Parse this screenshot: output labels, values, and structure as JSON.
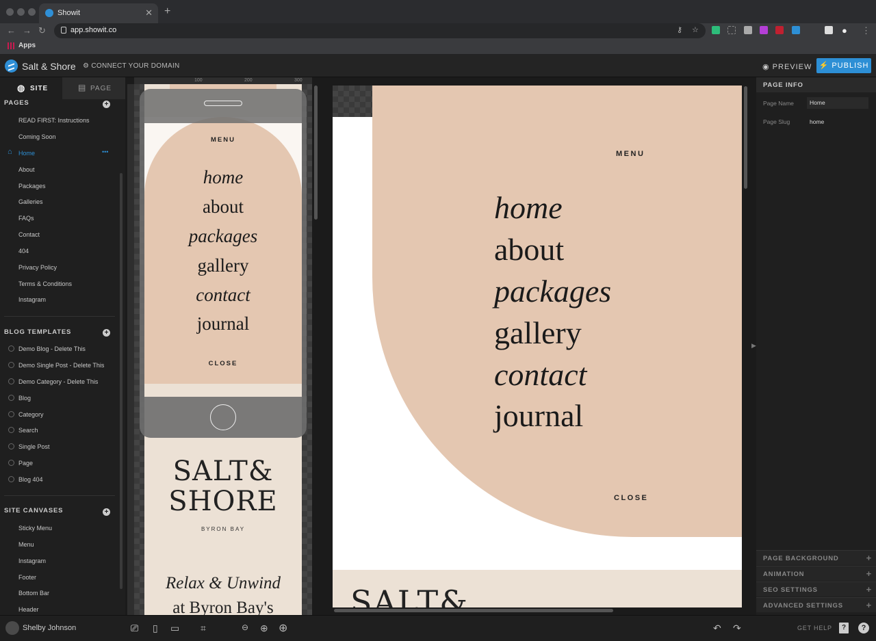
{
  "browser": {
    "tab_title": "Showit",
    "url": "app.showit.co",
    "bookmarks_label": "Apps"
  },
  "header": {
    "site_name": "Salt & Shore",
    "connect_domain": "CONNECT YOUR DOMAIN",
    "preview": "PREVIEW",
    "publish": "PUBLISH"
  },
  "sidebar": {
    "tab_site": "SITE",
    "tab_page": "PAGE",
    "pages_header": "PAGES",
    "pages": [
      "READ FIRST: Instructions",
      "Coming Soon",
      "Home",
      "About",
      "Packages",
      "Galleries",
      "FAQs",
      "Contact",
      "404",
      "Privacy Policy",
      "Terms & Conditions",
      "Instagram"
    ],
    "blog_header": "BLOG TEMPLATES",
    "blog_templates": [
      "Demo Blog - Delete This",
      "Demo Single Post - Delete This",
      "Demo Category - Delete This",
      "Blog",
      "Category",
      "Search",
      "Single Post",
      "Page",
      "Blog 404"
    ],
    "canvases_header": "SITE CANVASES",
    "canvases": [
      "Sticky Menu",
      "Menu",
      "Instagram",
      "Footer",
      "Bottom Bar",
      "Header"
    ],
    "more": "•••"
  },
  "ruler": {
    "t100": "100",
    "t200": "200",
    "t300": "300"
  },
  "design": {
    "menu": "MENU",
    "close": "CLOSE",
    "nav": [
      "home",
      "about",
      "packages",
      "gallery",
      "contact",
      "journal"
    ],
    "brand_line1": "SALT&",
    "brand_line2": "SHORE",
    "brand_sub": "BYRON BAY",
    "tagline1": "Relax & Unwind",
    "tagline2": "at Byron Bay's",
    "desk_brand": "SALT&"
  },
  "page_info": {
    "header": "PAGE INFO",
    "name_label": "Page Name",
    "name_value": "Home",
    "slug_label": "Page Slug",
    "slug_value": "home",
    "sections": [
      "PAGE BACKGROUND",
      "ANIMATION",
      "SEO SETTINGS",
      "ADVANCED SETTINGS"
    ]
  },
  "bottom": {
    "user": "Shelby Johnson",
    "get_help": "GET HELP"
  },
  "colors": {
    "accent": "#2d8fd5",
    "arch": "#e4c7b1",
    "cream": "#ece1d5"
  }
}
